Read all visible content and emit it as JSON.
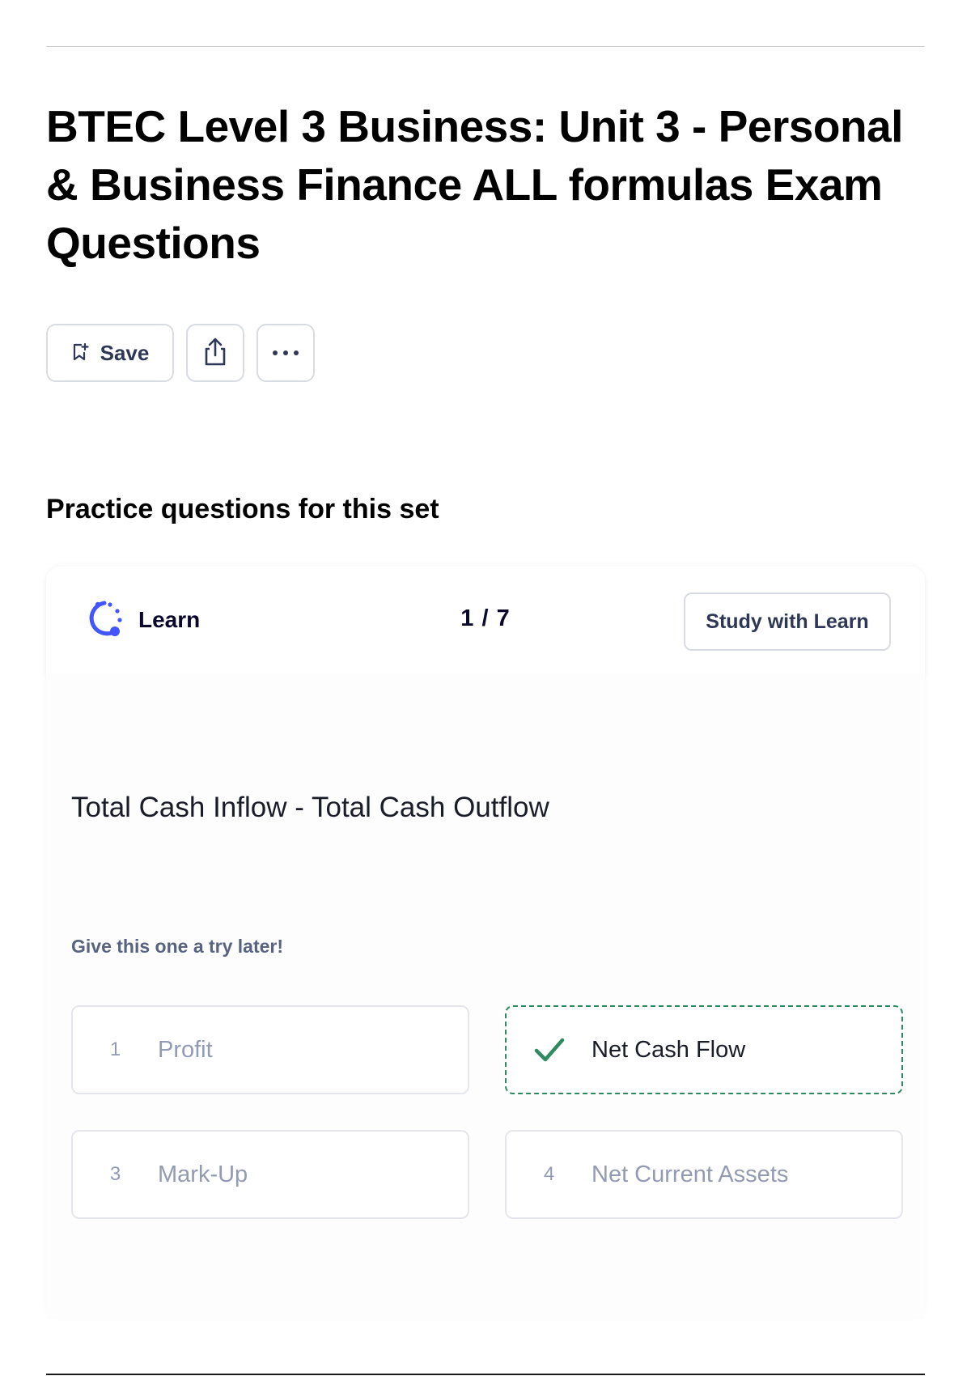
{
  "header": {
    "title": "BTEC Level 3 Business: Unit 3 - Personal & Business Finance ALL formulas Exam Questions"
  },
  "actions": {
    "save_label": "Save",
    "save_icon": "bookmark-plus-icon",
    "share_icon": "share-icon",
    "more_icon": "more-dots-icon"
  },
  "practice": {
    "heading": "Practice questions for this set",
    "mode_label": "Learn",
    "mode_icon": "learn-icon",
    "progress": "1 / 7",
    "study_button": "Study with Learn",
    "question": "Total Cash Inflow - Total Cash Outflow",
    "feedback": "Give this one a try later!",
    "options": [
      {
        "number": "1",
        "label": "Profit",
        "state": "default"
      },
      {
        "number": "",
        "label": "Net Cash Flow",
        "state": "correct",
        "icon": "check-icon"
      },
      {
        "number": "3",
        "label": "Mark-Up",
        "state": "default"
      },
      {
        "number": "4",
        "label": "Net Current Assets",
        "state": "default"
      }
    ]
  },
  "colors": {
    "accent": "#4255ff",
    "correct": "#2f8a62",
    "muted_text": "#939bb4",
    "secondary_text": "#586380",
    "border": "#d9dbe3"
  }
}
